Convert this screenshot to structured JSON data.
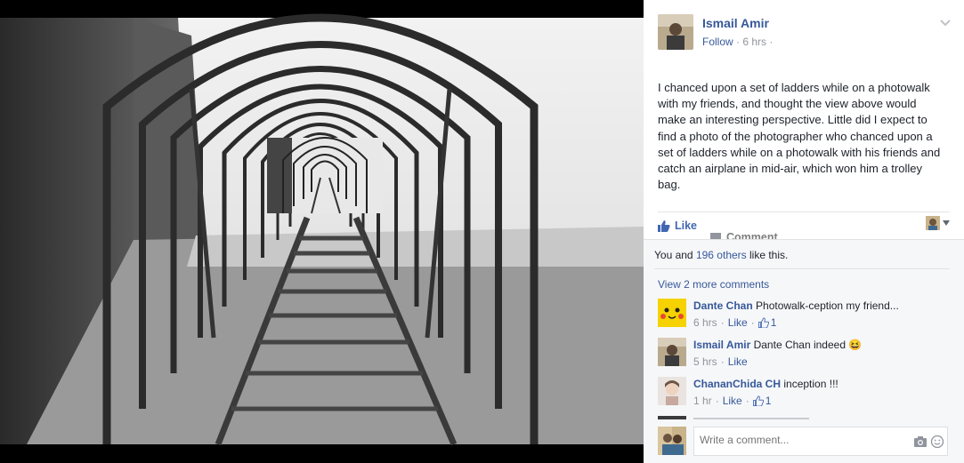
{
  "post": {
    "author": "Ismail Amir",
    "follow": "Follow",
    "sep": "·",
    "time": "6 hrs",
    "text": "I chanced upon a set of ladders while on a photowalk with my friends, and thought the view above would make an interesting perspective. Little did I expect to find a photo of the photographer who chanced upon a set of ladders while on a photowalk with his friends and catch an airplane in mid-air, which won him a trolley bag."
  },
  "actions": {
    "like": "Like",
    "comment": "Comment"
  },
  "likes": {
    "prefix": "You and ",
    "others": "196 others",
    "suffix": " like this."
  },
  "view_more": "View 2 more comments",
  "comments": [
    {
      "name": "Dante Chan",
      "text": "Photowalk-ception my friend...",
      "time": "6 hrs",
      "like": "Like",
      "likes": "1"
    },
    {
      "name": "Ismail Amir",
      "text": "Dante Chan indeed",
      "emoji": "😆",
      "time": "5 hrs",
      "like": "Like"
    },
    {
      "name": "ChananChida CH",
      "text": "inception !!!",
      "time": "1 hr",
      "like": "Like",
      "likes": "1"
    }
  ],
  "compose": {
    "placeholder": "Write a comment..."
  },
  "colors": {
    "link": "#365899",
    "accent": "#4267b2",
    "muted": "#90949c"
  },
  "icons": [
    "chevron-down-icon",
    "thumbs-up-icon",
    "comment-icon",
    "camera-icon",
    "emoji-icon"
  ]
}
